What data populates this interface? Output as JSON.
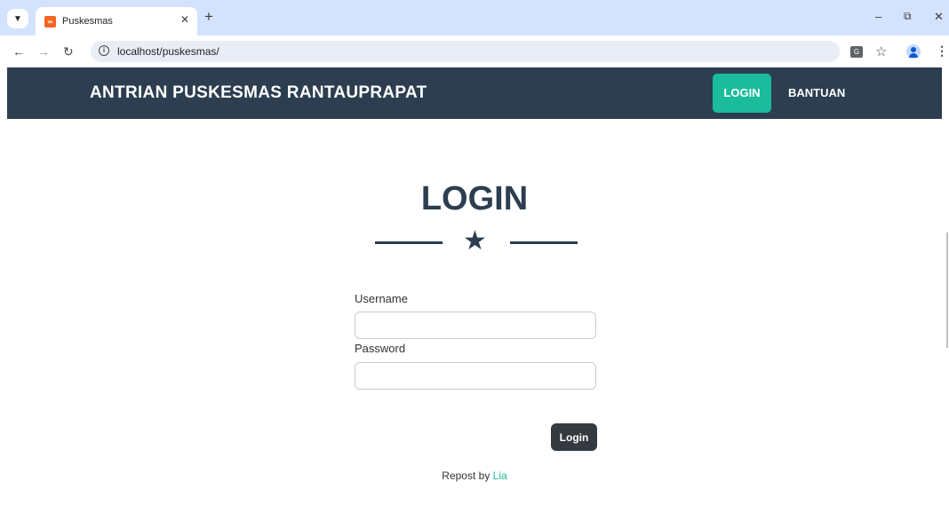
{
  "browser": {
    "tab_title": "Puskesmas",
    "url": "localhost/puskesmas/"
  },
  "navbar": {
    "brand": "ANTRIAN PUSKESMAS RANTAUPRAPAT",
    "login": "LOGIN",
    "help": "BANTUAN"
  },
  "main": {
    "heading": "LOGIN",
    "username_label": "Username",
    "username_value": "",
    "password_label": "Password",
    "password_value": "",
    "submit": "Login"
  },
  "footer": {
    "prefix": "Repost by",
    "author": "Lia"
  },
  "colors": {
    "navbar": "#2c3e50",
    "accent": "#1abc9c",
    "button": "#343a40"
  }
}
